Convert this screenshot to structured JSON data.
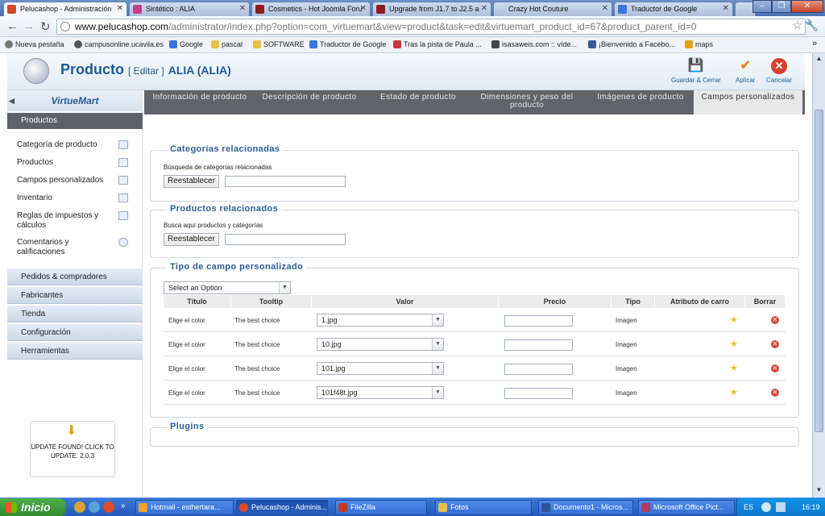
{
  "browser": {
    "tabs": [
      {
        "title": "Pelucashop - Administración",
        "color": "#d04a2a",
        "active": true
      },
      {
        "title": "Sintético : ALIA",
        "color": "#c23e8f"
      },
      {
        "title": "Cosmetics - Hot Joomla Foru",
        "color": "#8a1f1f"
      },
      {
        "title": "Upgrade from J1.7 to J2.5 a",
        "color": "#8a1f1f"
      },
      {
        "title": "Crazy Hot Couture",
        "color": "#cccccc"
      },
      {
        "title": "Traductor de Google",
        "color": "#3b77d8"
      }
    ],
    "url_host": "www.pelucashop.com",
    "url_path": "/administrator/index.php?option=com_virtuemart&view=product&task=edit&virtuemart_product_id=67&product_parent_id=0",
    "bookmarks": [
      {
        "label": "Nueva pestaña",
        "color": "#777777"
      },
      {
        "label": "campusonline.ucavila.es",
        "color": "#555555"
      },
      {
        "label": "Google",
        "color": "#3b77d8"
      },
      {
        "label": "pascal",
        "color": "#e6c04a"
      },
      {
        "label": "SOFTWARE",
        "color": "#e6c04a"
      },
      {
        "label": "Traductor de Google",
        "color": "#3b77d8"
      },
      {
        "label": "Tras la pista de Paula ...",
        "color": "#c43a3a"
      },
      {
        "label": "isasaweis.com :: víde...",
        "color": "#444444"
      },
      {
        "label": "¡Bienvenido a Facebo...",
        "color": "#3b5998"
      },
      {
        "label": "maps",
        "color": "#e3a316"
      }
    ],
    "more": "»"
  },
  "header": {
    "title": "Producto",
    "edit": "[ Editar ]",
    "name": "ALIA (ALIA)",
    "buttons": {
      "save_close": "Guardar & Cerrar",
      "apply": "Aplicar",
      "cancel": "Cancelar"
    }
  },
  "sidebar": {
    "logo": "VirtueMart",
    "section": "Productos",
    "items": [
      "Categoría de producto",
      "Productos",
      "Campos personalizados",
      "Inventario",
      "Reglas de impuestos y cálculos",
      "Comentarios y calificaciones"
    ],
    "groups": [
      "Pedidos & compradores",
      "Fabricantes",
      "Tienda",
      "Configuración",
      "Herramientas"
    ],
    "update": "UPDATE FOUND! CLICK TO UPDATE. 2.0.3"
  },
  "tabs": [
    "Información de producto",
    "Descripción de producto",
    "Estado de producto",
    "Dimensiones y peso del producto",
    "Imágenes de producto",
    "Campos personalizados"
  ],
  "categorias": {
    "legend": "Categorías relacionadas",
    "label": "Búsqueda de categorías relacionadas",
    "button": "Reestablecer"
  },
  "productos": {
    "legend": "Productos relacionados",
    "label": "Busca aquí productos y categorías",
    "button": "Reestablecer"
  },
  "custom": {
    "legend": "Tipo de campo personalizado",
    "select": "Select an Option",
    "headers": [
      "Título",
      "Tooltip",
      "Valor",
      "Precio",
      "Tipo",
      "Atributo de carro",
      "Borrar"
    ],
    "rows": [
      {
        "title": "Elige el color",
        "tooltip": "The best choice",
        "value": "1.jpg",
        "type": "Imagen"
      },
      {
        "title": "Elige el color",
        "tooltip": "The best choice",
        "value": "10.jpg",
        "type": "Imagen"
      },
      {
        "title": "Elige el color",
        "tooltip": "The best choice",
        "value": "101.jpg",
        "type": "Imagen"
      },
      {
        "title": "Elige el color",
        "tooltip": "The best choice",
        "value": "101f48t.jpg",
        "type": "Imagen"
      }
    ]
  },
  "plugins": {
    "legend": "Plugins"
  },
  "taskbar": {
    "start": "Inicio",
    "tasks": [
      "Hotmail - esthertara...",
      "Pelucashop - Adminis...",
      "FileZilla",
      "Fotos",
      "Documento1 - Micros...",
      "Microsoft Office Pict..."
    ],
    "lang": "ES",
    "time": "16:19"
  }
}
